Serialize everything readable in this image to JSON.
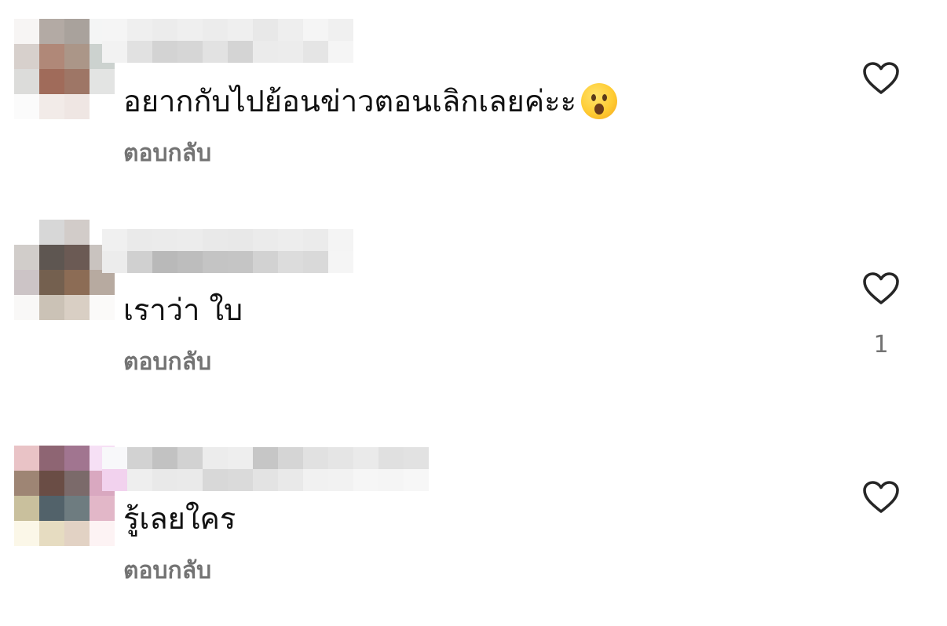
{
  "comments": [
    {
      "text": "อยากกับไปย้อนข่าวตอนเลิกเลยค่ะะ",
      "emoji": "hushed-face",
      "reply_label": "ตอบกลับ",
      "like_count": ""
    },
    {
      "text": "เราว่า ใบ",
      "emoji": "",
      "reply_label": "ตอบกลับ",
      "like_count": "1"
    },
    {
      "text": "รู้เลยใคร",
      "emoji": "",
      "reply_label": "ตอบกลับ",
      "like_count": ""
    }
  ],
  "icons": {
    "like": "heart-outline-icon",
    "emoji": "hushed-face-emoji"
  },
  "colors": {
    "text": "#111111",
    "secondary": "#737373",
    "icon": "#262626"
  }
}
